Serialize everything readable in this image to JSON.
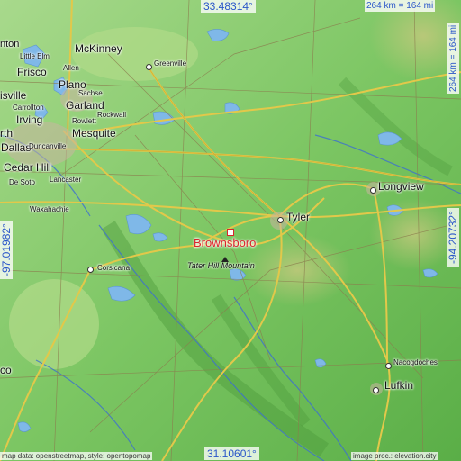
{
  "place": {
    "name": "Brownsboro",
    "color": "#d9242b"
  },
  "coords": {
    "top": "33.48314°",
    "bottom": "31.10601°",
    "left": "-97.01982°",
    "right": "-94.20732°"
  },
  "scale": {
    "horizontal": "264 km = 164 mi",
    "vertical": "264 km = 164 mi"
  },
  "credits": {
    "left": "map data: openstreetmap, style: opentopomap",
    "right": "image proc.: elevation.city"
  },
  "peak": {
    "name": "Tater Hill Mountain"
  },
  "cities": {
    "mckinney": "McKinney",
    "greenville": "Greenville",
    "anton": "nton",
    "little_elm": "Little Elm",
    "frisco": "Frisco",
    "allen": "Allen",
    "plano": "Plano",
    "sachse": "Sachse",
    "lewisville": "isville",
    "garland": "Garland",
    "carrollton": "Carrollton",
    "rockwall": "Rockwall",
    "irving": "Irving",
    "rowlett": "Rowlett",
    "mesquite": "Mesquite",
    "fort_worth": "rth",
    "dallas": "Dallas",
    "duncanville": "Duncanville",
    "cedar_hill": "Cedar Hill",
    "lancaster": "Lancaster",
    "desoto": "De Soto",
    "waxahachie": "Waxahachie",
    "corsicana": "Corsicana",
    "tyler": "Tyler",
    "longview": "Longview",
    "nacogdoches": "Nacogdoches",
    "lufkin": "Lufkin",
    "waco": "co"
  },
  "colors": {
    "lowland": "#8fd37a",
    "midland": "#6fbf55",
    "highland": "#c9c97a",
    "water": "#7fb8e8",
    "road_major": "#e2c84a",
    "road_minor": "#8b7d4e",
    "coord_text": "#2a56c9"
  }
}
